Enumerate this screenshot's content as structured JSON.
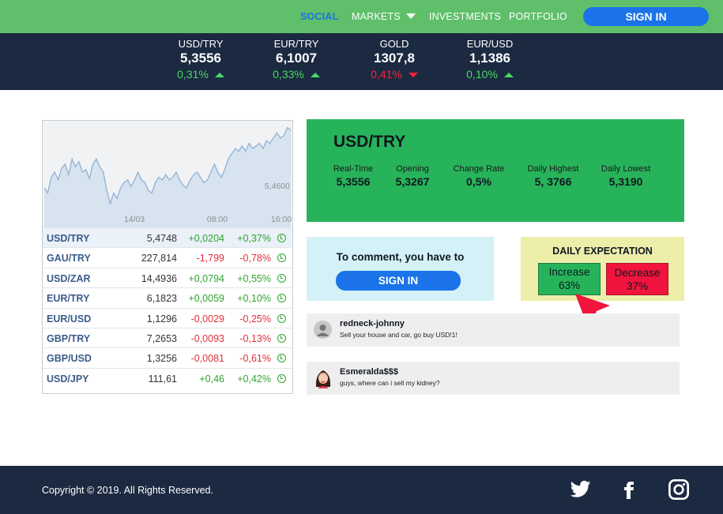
{
  "nav": {
    "items": [
      {
        "label": "SOCIAL",
        "active": true
      },
      {
        "label": "MARKETS",
        "active": false
      },
      {
        "label": "INVESTMENTS",
        "active": false
      },
      {
        "label": "PORTFOLIO",
        "active": false
      }
    ],
    "markets_dropdown_icon": "chevron-down-icon",
    "signin_label": "SIGN IN"
  },
  "ticker": [
    {
      "pair": "USD/TRY",
      "price": "5,3556",
      "change": "0,31%",
      "direction": "up"
    },
    {
      "pair": "EUR/TRY",
      "price": "6,1007",
      "change": "0,33%",
      "direction": "up"
    },
    {
      "pair": "GOLD",
      "price": "1307,8",
      "change": "0,41%",
      "direction": "down"
    },
    {
      "pair": "EUR/USD",
      "price": "1,1386",
      "change": "0,10%",
      "direction": "up"
    }
  ],
  "chart": {
    "price_label": "5,4600",
    "time_labels": [
      "14/03",
      "08:00",
      "16:00"
    ]
  },
  "chart_data": {
    "type": "area",
    "x_ticks": [
      "14/03",
      "08:00",
      "16:00"
    ],
    "ylabel": "",
    "y_tick_labels": [
      "5,4600"
    ],
    "series": [
      {
        "values": [
          5.44,
          5.436,
          5.448,
          5.452,
          5.446,
          5.455,
          5.458,
          5.45,
          5.462,
          5.456,
          5.46,
          5.452,
          5.454,
          5.447,
          5.458,
          5.462,
          5.456,
          5.452,
          5.438,
          5.428,
          5.436,
          5.432,
          5.44,
          5.444,
          5.446,
          5.441,
          5.446,
          5.452,
          5.446,
          5.444,
          5.438,
          5.436,
          5.444,
          5.448,
          5.446,
          5.45,
          5.446,
          5.448,
          5.452,
          5.446,
          5.442,
          5.44,
          5.446,
          5.45,
          5.452,
          5.448,
          5.444,
          5.446,
          5.452,
          5.458,
          5.452,
          5.448,
          5.454,
          5.462,
          5.466,
          5.47,
          5.468,
          5.472,
          5.468,
          5.474,
          5.47,
          5.472,
          5.474,
          5.47,
          5.476,
          5.474,
          5.478,
          5.482,
          5.478,
          5.48,
          5.486,
          5.484
        ]
      }
    ],
    "colors": {
      "line": "#8fb2d6",
      "fill": "#d7e3ef",
      "background": "#f1f2f4"
    }
  },
  "fx_table": [
    {
      "pair": "USD/TRY",
      "value": "5,4748",
      "change": "+0,0204",
      "percent": "+0,37%",
      "sign": "pos"
    },
    {
      "pair": "GAU/TRY",
      "value": "227,814",
      "change": "-1,799",
      "percent": "-0,78%",
      "sign": "neg"
    },
    {
      "pair": "USD/ZAR",
      "value": "14,4936",
      "change": "+0,0794",
      "percent": "+0,55%",
      "sign": "pos"
    },
    {
      "pair": "EUR/TRY",
      "value": "6,1823",
      "change": "+0,0059",
      "percent": "+0,10%",
      "sign": "pos"
    },
    {
      "pair": "EUR/USD",
      "value": "1,1296",
      "change": "-0,0029",
      "percent": "-0,25%",
      "sign": "neg"
    },
    {
      "pair": "GBP/TRY",
      "value": "7,2653",
      "change": "-0,0093",
      "percent": "-0,13%",
      "sign": "neg"
    },
    {
      "pair": "GBP/USD",
      "value": "1,3256",
      "change": "-0,0081",
      "percent": "-0,61%",
      "sign": "neg"
    },
    {
      "pair": "USD/JPY",
      "value": "111,61",
      "change": "+0,46",
      "percent": "+0,42%",
      "sign": "pos"
    }
  ],
  "info": {
    "title": "USD/TRY",
    "stats": [
      {
        "label": "Real-Time",
        "value": "5,3556"
      },
      {
        "label": "Opening",
        "value": "5,3267"
      },
      {
        "label": "Change Rate",
        "value": "0,5%"
      },
      {
        "label": "Daily Highest",
        "value": "5, 3766"
      },
      {
        "label": "Daily Lowest",
        "value": "5,3190"
      }
    ]
  },
  "comment_prompt": {
    "text": "To comment, you have to",
    "signin_label": "SIGN IN"
  },
  "expectation": {
    "title": "DAILY EXPECTATION",
    "increase_label": "Increase",
    "increase_pct": "63%",
    "decrease_label": "Decrease",
    "decrease_pct": "37%"
  },
  "comments": [
    {
      "user": "redneck-johnny",
      "text": "Sell your house and car, go buy USD!1!",
      "avatar": "default-avatar-icon"
    },
    {
      "user": "Esmeralda$$$",
      "text": "guys, where can i sell my kidney?",
      "avatar": "woman-avatar-icon"
    }
  ],
  "footer": {
    "copyright": "Copyright © 2019. All Rights Reserved.",
    "social_icons": [
      "twitter-icon",
      "facebook-icon",
      "instagram-icon"
    ]
  },
  "colors": {
    "nav_bg": "#5fbf6a",
    "dark_bg": "#1b2a41",
    "accent_blue": "#1a73e8",
    "positive": "#4cd964",
    "negative": "#ff1f3a",
    "info_green": "#27b35a",
    "comment_bg": "#d3f1f7",
    "expect_bg": "#eceeaa"
  }
}
